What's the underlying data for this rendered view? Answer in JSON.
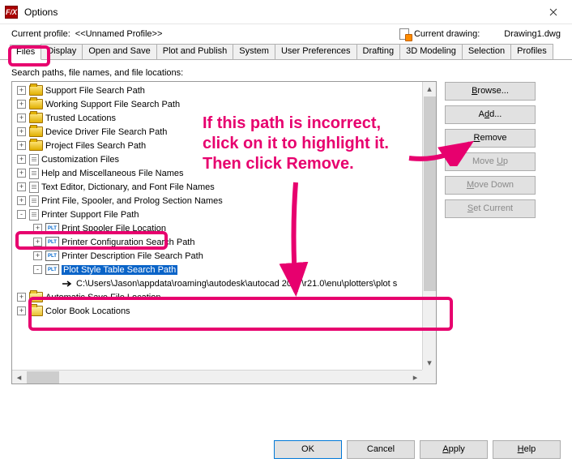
{
  "window": {
    "title": "Options",
    "app_icon_text": "F/X"
  },
  "profile": {
    "label": "Current profile:",
    "value": "<<Unnamed Profile>>",
    "drawing_label": "Current drawing:",
    "drawing_value": "Drawing1.dwg"
  },
  "tabs": [
    "Files",
    "Display",
    "Open and Save",
    "Plot and Publish",
    "System",
    "User Preferences",
    "Drafting",
    "3D Modeling",
    "Selection",
    "Profiles"
  ],
  "active_tab": "Files",
  "tree_label": "Search paths, file names, and file locations:",
  "tree_nodes": [
    {
      "depth": 0,
      "expander": "+",
      "icon": "folder-closed",
      "label": "Support File Search Path"
    },
    {
      "depth": 0,
      "expander": "+",
      "icon": "folder-closed",
      "label": "Working Support File Search Path"
    },
    {
      "depth": 0,
      "expander": "+",
      "icon": "folder-closed",
      "label": "Trusted Locations"
    },
    {
      "depth": 0,
      "expander": "+",
      "icon": "folder-closed",
      "label": "Device Driver File Search Path"
    },
    {
      "depth": 0,
      "expander": "+",
      "icon": "folder-closed",
      "label": "Project Files Search Path"
    },
    {
      "depth": 0,
      "expander": "+",
      "icon": "file",
      "label": "Customization Files"
    },
    {
      "depth": 0,
      "expander": "+",
      "icon": "file",
      "label": "Help and Miscellaneous File Names"
    },
    {
      "depth": 0,
      "expander": "+",
      "icon": "file",
      "label": "Text Editor, Dictionary, and Font File Names"
    },
    {
      "depth": 0,
      "expander": "+",
      "icon": "file",
      "label": "Print File, Spooler, and Prolog Section Names"
    },
    {
      "depth": 0,
      "expander": "-",
      "icon": "file",
      "label": "Printer Support File Path"
    },
    {
      "depth": 1,
      "expander": "+",
      "icon": "plt",
      "label": "Print Spooler File Location"
    },
    {
      "depth": 1,
      "expander": "+",
      "icon": "plt",
      "label": "Printer Configuration Search Path"
    },
    {
      "depth": 1,
      "expander": "+",
      "icon": "plt",
      "label": "Printer Description File Search Path"
    },
    {
      "depth": 1,
      "expander": "-",
      "icon": "plt",
      "label": "Plot Style Table Search Path",
      "selected": true
    },
    {
      "depth": 2,
      "expander": " ",
      "icon": "arrow",
      "label": "C:\\Users\\Jason\\appdata\\roaming\\autodesk\\autocad 2017\\r21.0\\enu\\plotters\\plot s"
    },
    {
      "depth": 0,
      "expander": "+",
      "icon": "folder-open",
      "label": "Automatic Save File Location"
    },
    {
      "depth": 0,
      "expander": "+",
      "icon": "folder-open",
      "label": "Color Book Locations"
    }
  ],
  "side_buttons": [
    {
      "label": "Browse...",
      "hotkey": "B",
      "enabled": true
    },
    {
      "label": "Add...",
      "hotkey": "d",
      "enabled": true
    },
    {
      "label": "Remove",
      "hotkey": "R",
      "enabled": true
    },
    {
      "label": "Move Up",
      "hotkey": "U",
      "enabled": false
    },
    {
      "label": "Move Down",
      "hotkey": "M",
      "enabled": false
    },
    {
      "label": "Set Current",
      "hotkey": "S",
      "enabled": false
    }
  ],
  "bottom_buttons": [
    {
      "label": "OK",
      "primary": true
    },
    {
      "label": "Cancel",
      "primary": false
    },
    {
      "label": "Apply",
      "primary": false,
      "hotkey": "A"
    },
    {
      "label": "Help",
      "primary": false,
      "hotkey": "H"
    }
  ],
  "annotations": {
    "text": "If this path is incorrect, click on it to highlight it. Then click Remove."
  }
}
